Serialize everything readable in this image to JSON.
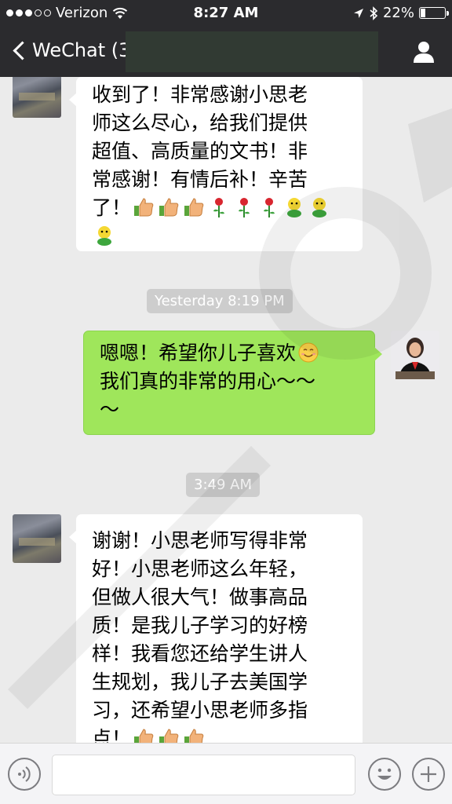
{
  "status_bar": {
    "carrier": "Verizon",
    "time": "8:27 AM",
    "battery": "22%",
    "battery_level": 0.22
  },
  "nav": {
    "back_label": "WeChat (3"
  },
  "messages": [
    {
      "side": "left",
      "text_lines": [
        "收到了！非常感谢小思老",
        "师这么尽心，给我们提供",
        "超值、高质量的文书！非",
        "常感谢！有情后补！辛苦",
        "了！"
      ],
      "emoji": [
        "thumbs-up",
        "thumbs-up",
        "thumbs-up",
        "rose",
        "rose",
        "rose",
        "chick",
        "chick",
        "chick"
      ]
    },
    {
      "timestamp": "Yesterday 8:19 PM"
    },
    {
      "side": "right",
      "text_lines": [
        "嗯嗯！希望你儿子喜欢",
        "我们真的非常的用心～～",
        "～"
      ],
      "emoji": [
        "smile"
      ]
    },
    {
      "timestamp": "3:49 AM"
    },
    {
      "side": "left",
      "text_lines": [
        "谢谢！小思老师写得非常",
        "好！小思老师这么年轻，",
        "但做人很大气！做事高品",
        "质！是我儿子学习的好榜",
        "样！我看您还给学生讲人",
        "生规划，我儿子去美国学",
        "习，还希望小思老师多指",
        "点！"
      ],
      "emoji": [
        "thumbs-up",
        "thumbs-up",
        "thumbs-up"
      ]
    }
  ],
  "input": {
    "placeholder": ""
  },
  "icons": {
    "voice": "voice-icon",
    "emoji": "emoji-icon",
    "plus": "plus-icon",
    "profile": "profile-icon"
  },
  "colors": {
    "bar": "#2b2b2e",
    "chat_bg": "#ebebeb",
    "bubble_out": "#9fe65b",
    "bubble_in": "#ffffff",
    "timestamp_bg": "#cdcdcd"
  }
}
